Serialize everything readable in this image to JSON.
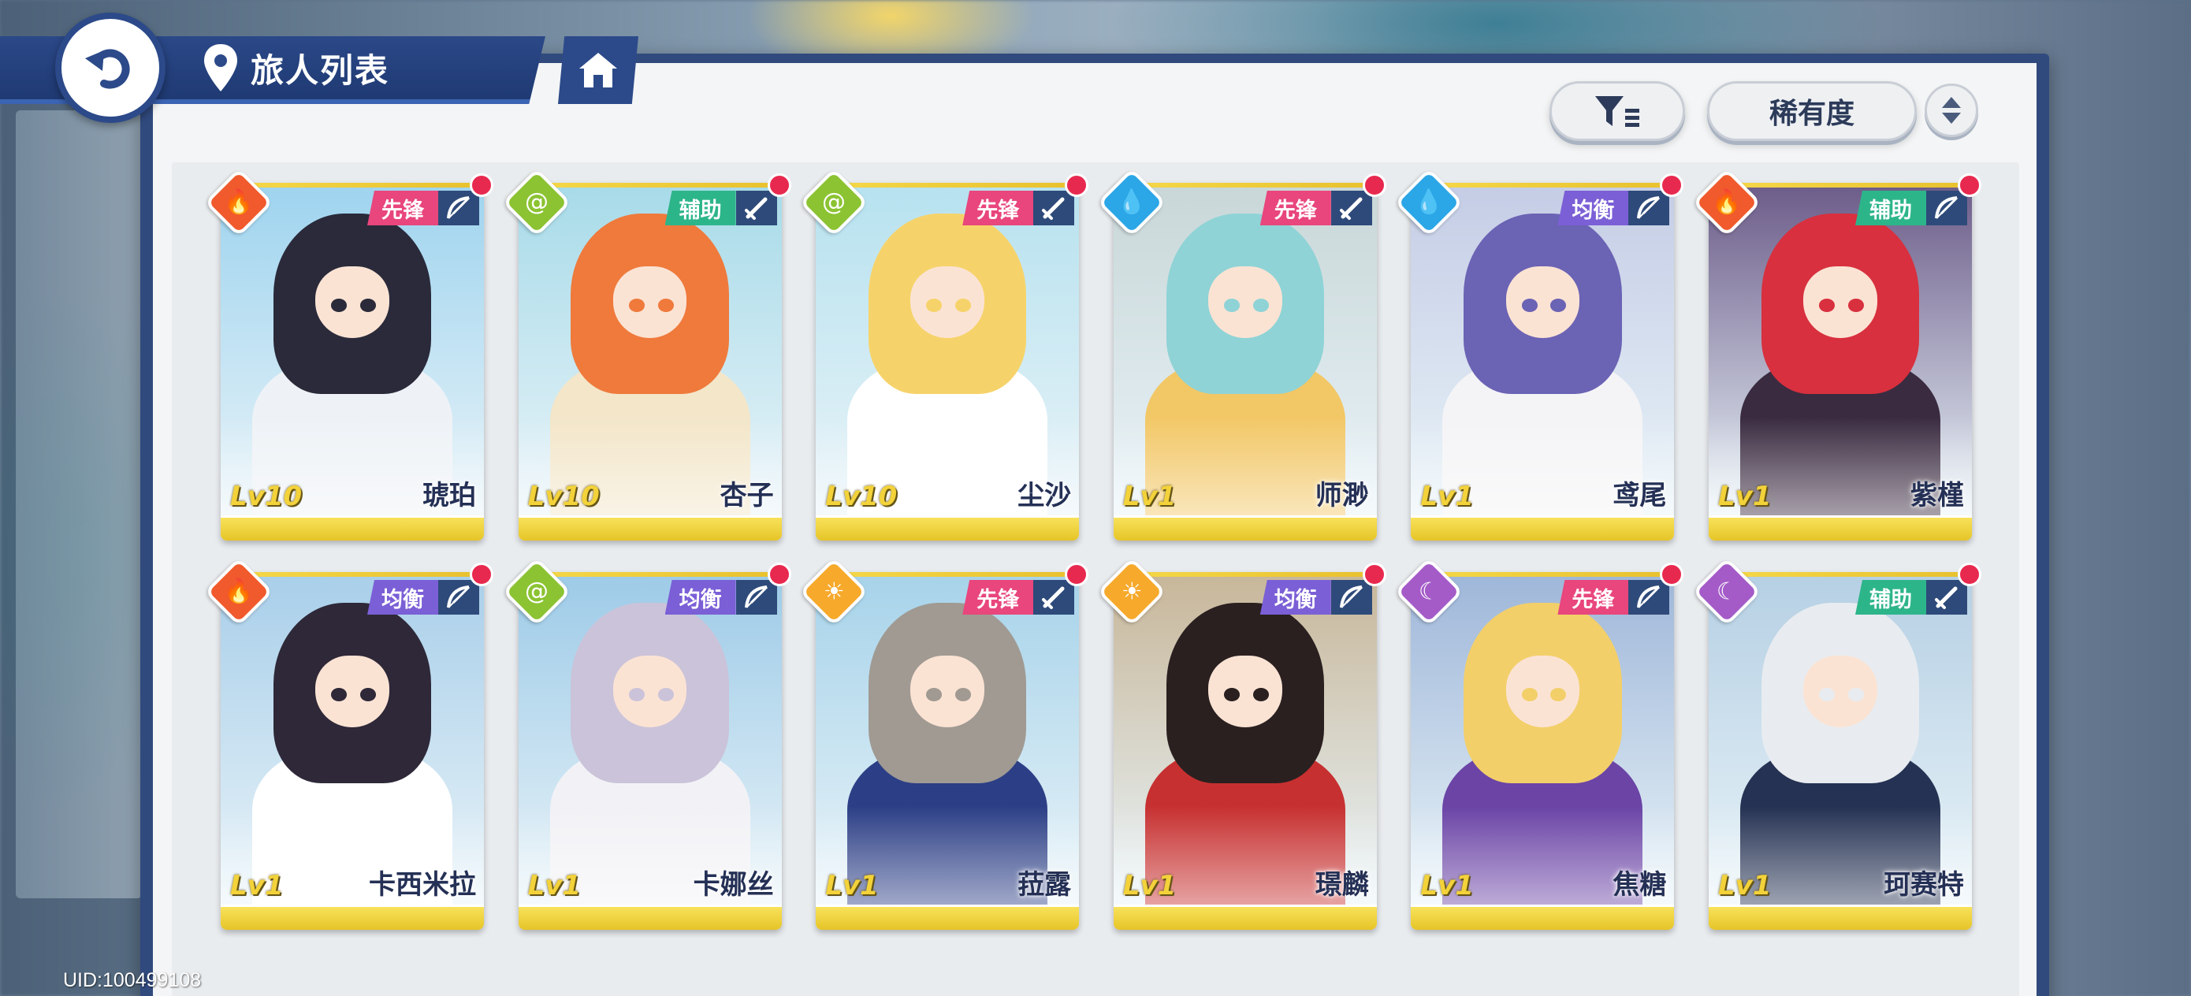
{
  "header": {
    "title": "旅人列表"
  },
  "toolbar": {
    "sort_label": "稀有度"
  },
  "uid": "UID:100499108",
  "colors": {
    "vanguard": "#e8467c",
    "support": "#2db58a",
    "balanced": "#7b5fd6",
    "fire": "#f05a2c",
    "wind": "#8bc332",
    "water": "#2ba6e6",
    "light": "#f6a92b",
    "dark": "#a45bc8"
  },
  "cards": [
    {
      "name": "琥珀",
      "level": "Lv10",
      "role": "先锋",
      "role_type": "vanguard",
      "element": "fire",
      "weapon": "bow-icon"
    },
    {
      "name": "杏子",
      "level": "Lv10",
      "role": "辅助",
      "role_type": "support",
      "element": "wind",
      "weapon": "sword-icon"
    },
    {
      "name": "尘沙",
      "level": "Lv10",
      "role": "先锋",
      "role_type": "vanguard",
      "element": "wind",
      "weapon": "sword-icon"
    },
    {
      "name": "师渺",
      "level": "Lv1",
      "role": "先锋",
      "role_type": "vanguard",
      "element": "water",
      "weapon": "sword-icon"
    },
    {
      "name": "鸢尾",
      "level": "Lv1",
      "role": "均衡",
      "role_type": "balanced",
      "element": "water",
      "weapon": "bow-icon"
    },
    {
      "name": "紫槿",
      "level": "Lv1",
      "role": "辅助",
      "role_type": "support",
      "element": "fire",
      "weapon": "bow-icon"
    },
    {
      "name": "卡西米拉",
      "level": "Lv1",
      "role": "均衡",
      "role_type": "balanced",
      "element": "fire",
      "weapon": "bow-icon"
    },
    {
      "name": "卡娜丝",
      "level": "Lv1",
      "role": "均衡",
      "role_type": "balanced",
      "element": "wind",
      "weapon": "bow-icon"
    },
    {
      "name": "菈露",
      "level": "Lv1",
      "role": "先锋",
      "role_type": "vanguard",
      "element": "light",
      "weapon": "sword-icon"
    },
    {
      "name": "璟麟",
      "level": "Lv1",
      "role": "均衡",
      "role_type": "balanced",
      "element": "light",
      "weapon": "bow-icon"
    },
    {
      "name": "焦糖",
      "level": "Lv1",
      "role": "先锋",
      "role_type": "vanguard",
      "element": "dark",
      "weapon": "bow-icon"
    },
    {
      "name": "珂赛特",
      "level": "Lv1",
      "role": "辅助",
      "role_type": "support",
      "element": "dark",
      "weapon": "sword-icon"
    }
  ]
}
